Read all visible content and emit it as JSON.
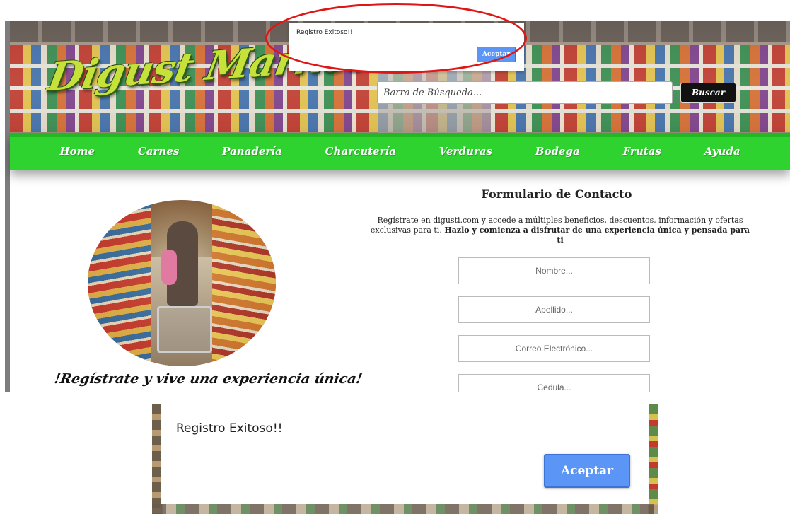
{
  "header": {
    "logo_text": "Digust Market!",
    "search_placeholder": "Barra de Búsqueda...",
    "search_button": "Buscar"
  },
  "nav": {
    "items": [
      "Home",
      "Carnes",
      "Panadería",
      "Charcutería",
      "Verduras",
      "Bodega",
      "Frutas",
      "Ayuda"
    ]
  },
  "hero_left": {
    "tagline": "!Regístrate y vive una experiencia única!"
  },
  "form": {
    "title": "Formulario de Contacto",
    "description_plain": "Regístrate en digusti.com y accede a múltiples beneficios, descuentos, información y ofertas exclusivas para ti.",
    "description_bold": "Hazlo y comienza a disfrutar de una experiencia única y pensada para ti",
    "fields": {
      "nombre": "Nombre...",
      "apellido": "Apellido...",
      "correo": "Correo Electrónico...",
      "cedula": "Cedula..."
    }
  },
  "alert": {
    "message": "Registro Exitoso!!",
    "button": "Aceptar"
  },
  "colors": {
    "nav_green": "#2fd32f",
    "alert_button_blue": "#5b95f5",
    "highlight_red": "#e01515",
    "logo_yellow_green": "#c6e23a"
  }
}
